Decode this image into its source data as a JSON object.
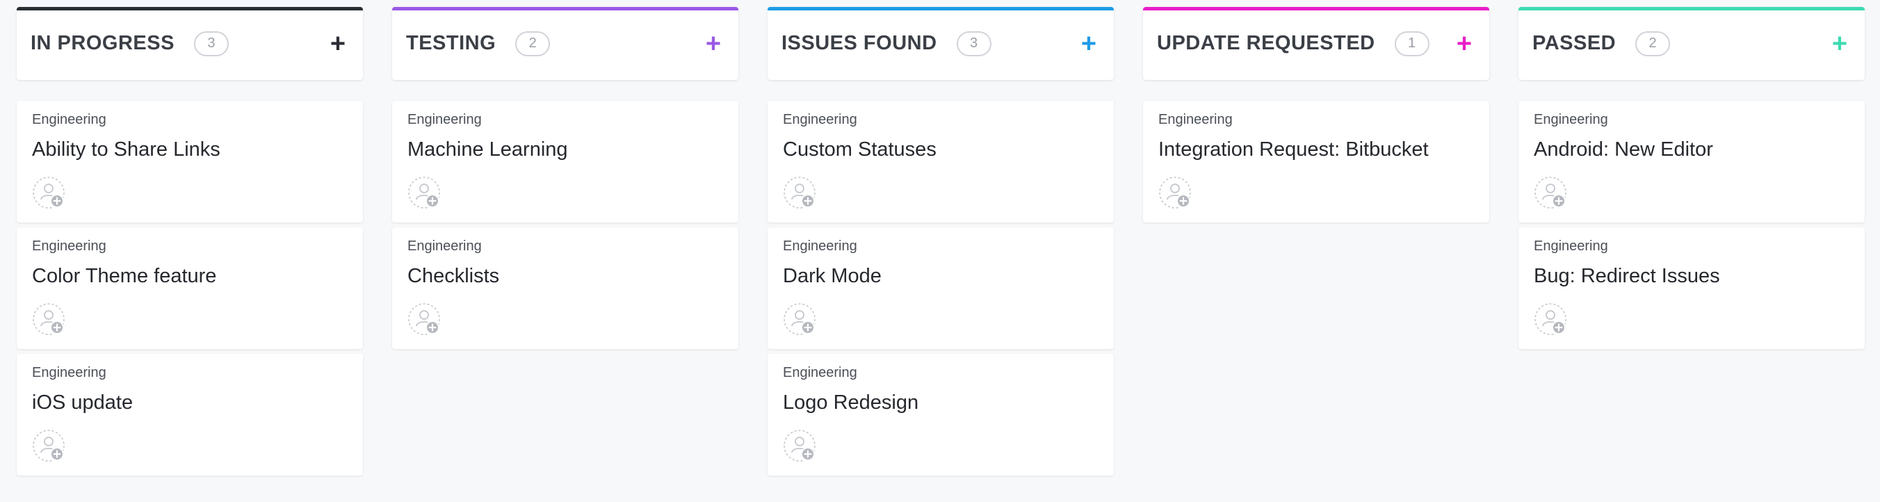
{
  "columns": [
    {
      "title": "IN PROGRESS",
      "count": "3",
      "color": "#2a2e34",
      "add_icon": "plus-icon",
      "cards": [
        {
          "tag": "Engineering",
          "title": "Ability to Share Links"
        },
        {
          "tag": "Engineering",
          "title": "Color Theme feature"
        },
        {
          "tag": "Engineering",
          "title": "iOS update"
        }
      ]
    },
    {
      "title": "TESTING",
      "count": "2",
      "color": "#9b59e6",
      "add_icon": "plus-icon",
      "cards": [
        {
          "tag": "Engineering",
          "title": "Machine Learning"
        },
        {
          "tag": "Engineering",
          "title": "Checklists"
        }
      ]
    },
    {
      "title": "ISSUES FOUND",
      "count": "3",
      "color": "#1e9be6",
      "add_icon": "plus-icon",
      "cards": [
        {
          "tag": "Engineering",
          "title": "Custom Statuses"
        },
        {
          "tag": "Engineering",
          "title": "Dark Mode"
        },
        {
          "tag": "Engineering",
          "title": "Logo Redesign"
        }
      ]
    },
    {
      "title": "UPDATE REQUESTED",
      "count": "1",
      "color": "#e91ec7",
      "add_icon": "plus-icon",
      "cards": [
        {
          "tag": "Engineering",
          "title": "Integration Request: Bitbucket"
        }
      ]
    },
    {
      "title": "PASSED",
      "count": "2",
      "color": "#3ddbb1",
      "add_icon": "plus-icon",
      "cards": [
        {
          "tag": "Engineering",
          "title": "Android: New Editor"
        },
        {
          "tag": "Engineering",
          "title": "Bug: Redirect Issues"
        }
      ]
    }
  ],
  "add_symbol": "+",
  "assignee_icon": "add-assignee-icon"
}
